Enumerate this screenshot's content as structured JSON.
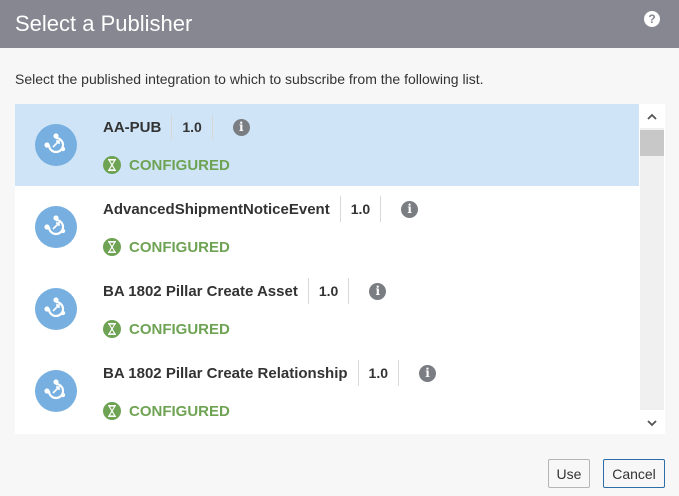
{
  "header": {
    "title": "Select a Publisher",
    "help_glyph": "?"
  },
  "instructions": "Select the published integration to which to subscribe from the following list.",
  "list": {
    "items": [
      {
        "name": "AA-PUB",
        "version": "1.0",
        "status": "CONFIGURED",
        "selected": true
      },
      {
        "name": "AdvancedShipmentNoticeEvent",
        "version": "1.0",
        "status": "CONFIGURED",
        "selected": false
      },
      {
        "name": "BA 1802 Pillar Create Asset",
        "version": "1.0",
        "status": "CONFIGURED",
        "selected": false
      },
      {
        "name": "BA 1802 Pillar Create Relationship",
        "version": "1.0",
        "status": "CONFIGURED",
        "selected": false
      }
    ],
    "icons": {
      "item": "integration-icon",
      "info": "info-icon",
      "status": "hourglass-icon"
    },
    "info_glyph": "i"
  },
  "footer": {
    "use_label": "Use",
    "cancel_label": "Cancel"
  },
  "colors": {
    "header_bg": "#868790",
    "selected_bg": "#cfe5f7",
    "icon_bg": "#76afe0",
    "status_green": "#6fa354"
  }
}
